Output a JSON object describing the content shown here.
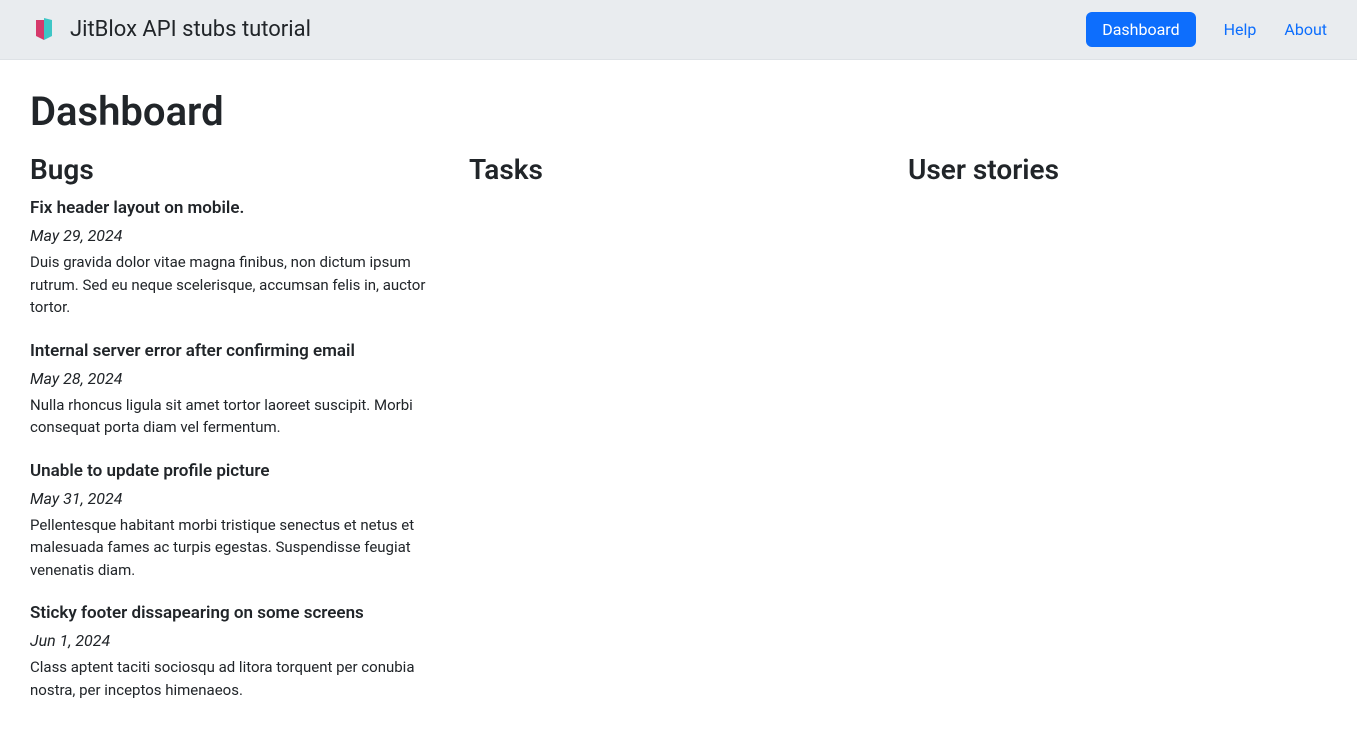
{
  "header": {
    "brand": "JitBlox API stubs tutorial",
    "nav": {
      "dashboard": "Dashboard",
      "help": "Help",
      "about": "About"
    }
  },
  "main": {
    "title": "Dashboard",
    "columns": {
      "bugs": {
        "heading": "Bugs",
        "items": [
          {
            "title": "Fix header layout on mobile.",
            "date": "May 29, 2024",
            "desc": "Duis gravida dolor vitae magna finibus, non dictum ipsum rutrum. Sed eu neque scelerisque, accumsan felis in, auctor tortor."
          },
          {
            "title": "Internal server error after confirming email",
            "date": "May 28, 2024",
            "desc": "Nulla rhoncus ligula sit amet tortor laoreet suscipit. Morbi consequat porta diam vel fermentum."
          },
          {
            "title": "Unable to update profile picture",
            "date": "May 31, 2024",
            "desc": "Pellentesque habitant morbi tristique senectus et netus et malesuada fames ac turpis egestas. Suspendisse feugiat venenatis diam."
          },
          {
            "title": "Sticky footer dissapearing on some screens",
            "date": "Jun 1, 2024",
            "desc": "Class aptent taciti sociosqu ad litora torquent per conubia nostra, per inceptos himenaeos."
          }
        ]
      },
      "tasks": {
        "heading": "Tasks"
      },
      "user_stories": {
        "heading": "User stories"
      }
    }
  }
}
